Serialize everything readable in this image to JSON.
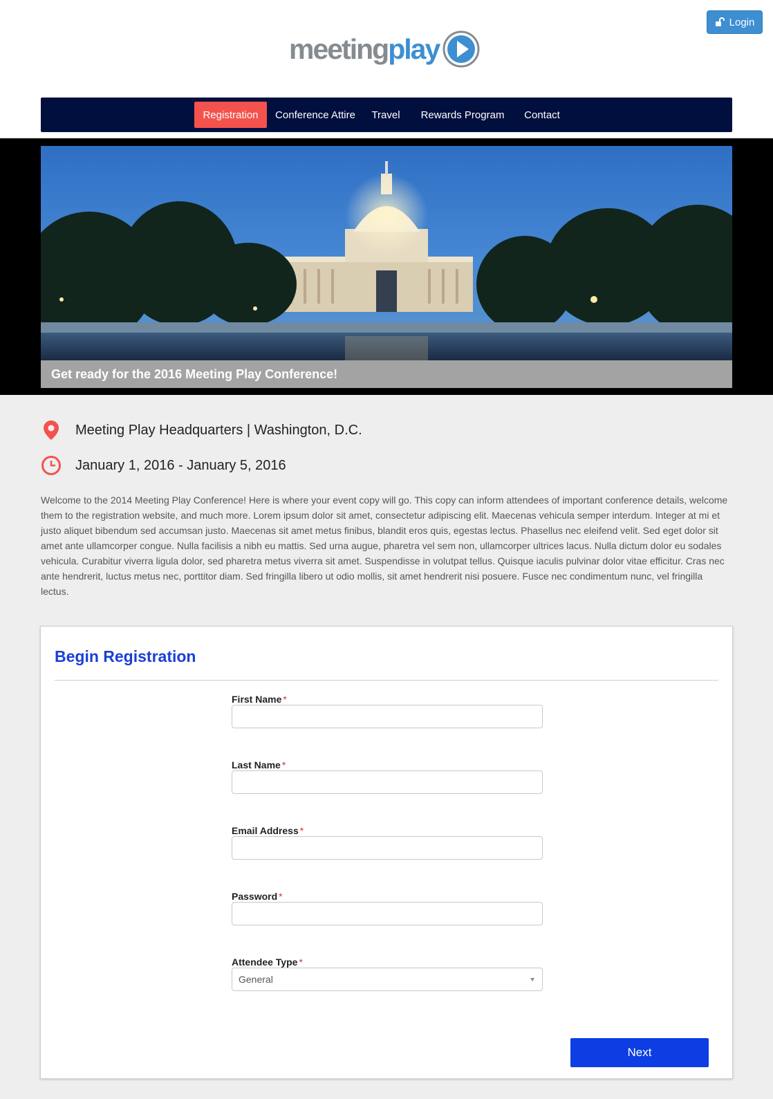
{
  "header": {
    "login_label": "Login",
    "logo": {
      "part1": "meeting",
      "part2": "play"
    }
  },
  "nav": {
    "items": [
      {
        "label": "Registration",
        "active": true
      },
      {
        "label": "Conference Attire"
      },
      {
        "label": "Travel"
      },
      {
        "label": "Rewards Program"
      },
      {
        "label": "Contact"
      }
    ]
  },
  "hero": {
    "caption": "Get ready for the 2016 Meeting Play Conference!"
  },
  "event": {
    "location": "Meeting Play Headquarters | Washington, D.C.",
    "dates": "January 1, 2016 - January 5, 2016",
    "description": "Welcome to the 2014 Meeting Play Conference! Here is where your event copy will go. This copy can inform attendees of important conference details, welcome them to the registration website, and much more. Lorem ipsum dolor sit amet, consectetur adipiscing elit. Maecenas vehicula semper interdum. Integer at mi et justo aliquet bibendum sed accumsan justo. Maecenas sit amet metus finibus, blandit eros quis, egestas lectus. Phasellus nec eleifend velit. Sed eget dolor sit amet ante ullamcorper congue. Nulla facilisis a nibh eu mattis. Sed urna augue, pharetra vel sem non, ullamcorper ultrices lacus. Nulla dictum dolor eu sodales vehicula. Curabitur viverra ligula dolor, sed pharetra metus viverra sit amet. Suspendisse in volutpat tellus. Quisque iaculis pulvinar dolor vitae efficitur. Cras nec ante hendrerit, luctus metus nec, porttitor diam. Sed fringilla libero ut odio mollis, sit amet hendrerit nisi posuere. Fusce nec condimentum nunc, vel fringilla lectus."
  },
  "registration": {
    "title": "Begin Registration",
    "required_mark": "*",
    "fields": [
      {
        "label": "First Name",
        "value": ""
      },
      {
        "label": "Last Name",
        "value": ""
      },
      {
        "label": "Email Address",
        "value": ""
      },
      {
        "label": "Password",
        "value": ""
      },
      {
        "label": "Attendee Type",
        "value": "General"
      }
    ],
    "next_label": "Next"
  },
  "colors": {
    "nav_bg": "#000f3d",
    "nav_active": "#f4524d",
    "accent_blue": "#3d8fd1",
    "title_blue": "#1a3fd6",
    "button_blue": "#0c3ee3",
    "icon_red": "#f4524d"
  }
}
